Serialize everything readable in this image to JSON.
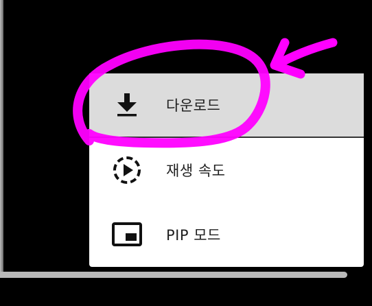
{
  "menu": {
    "items": [
      {
        "label": "다운로드",
        "icon": "download-icon"
      },
      {
        "label": "재생 속도",
        "icon": "playback-speed-icon"
      },
      {
        "label": "PIP 모드",
        "icon": "pip-mode-icon"
      }
    ],
    "highlighted_index": 0
  },
  "colors": {
    "annotation": "#ff00ff",
    "highlight": "#dcdcdc",
    "menu_bg": "#ffffff",
    "background": "#000000",
    "progress_track": "#b9b9b9"
  }
}
